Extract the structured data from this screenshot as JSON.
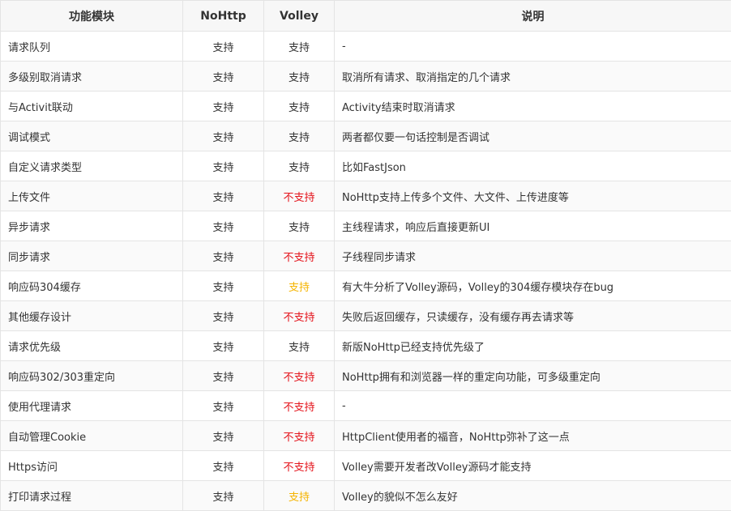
{
  "colors": {
    "supported": "#333333",
    "unsupported": "#e4121a",
    "partial": "#f5b400"
  },
  "table": {
    "headers": [
      "功能模块",
      "NoHttp",
      "Volley",
      "说明"
    ],
    "rows": [
      {
        "feature": "请求队列",
        "nohttp": "支持",
        "volley": "支持",
        "volley_status": "yes",
        "note": "-"
      },
      {
        "feature": "多级别取消请求",
        "nohttp": "支持",
        "volley": "支持",
        "volley_status": "yes",
        "note": "取消所有请求、取消指定的几个请求"
      },
      {
        "feature": "与Activit联动",
        "nohttp": "支持",
        "volley": "支持",
        "volley_status": "yes",
        "note": "Activity结束时取消请求"
      },
      {
        "feature": "调试模式",
        "nohttp": "支持",
        "volley": "支持",
        "volley_status": "yes",
        "note": "两者都仅要一句话控制是否调试"
      },
      {
        "feature": "自定义请求类型",
        "nohttp": "支持",
        "volley": "支持",
        "volley_status": "yes",
        "note": "比如FastJson"
      },
      {
        "feature": "上传文件",
        "nohttp": "支持",
        "volley": "不支持",
        "volley_status": "no",
        "note": "NoHttp支持上传多个文件、大文件、上传进度等"
      },
      {
        "feature": "异步请求",
        "nohttp": "支持",
        "volley": "支持",
        "volley_status": "yes",
        "note": "主线程请求，响应后直接更新UI"
      },
      {
        "feature": "同步请求",
        "nohttp": "支持",
        "volley": "不支持",
        "volley_status": "no",
        "note": "子线程同步请求"
      },
      {
        "feature": "响应码304缓存",
        "nohttp": "支持",
        "volley": "支持",
        "volley_status": "partial",
        "note": "有大牛分析了Volley源码，Volley的304缓存模块存在bug"
      },
      {
        "feature": "其他缓存设计",
        "nohttp": "支持",
        "volley": "不支持",
        "volley_status": "no",
        "note": "失败后返回缓存，只读缓存，没有缓存再去请求等"
      },
      {
        "feature": "请求优先级",
        "nohttp": "支持",
        "volley": "支持",
        "volley_status": "yes",
        "note": "新版NoHttp已经支持优先级了"
      },
      {
        "feature": "响应码302/303重定向",
        "nohttp": "支持",
        "volley": "不支持",
        "volley_status": "no",
        "note": "NoHttp拥有和浏览器一样的重定向功能，可多级重定向"
      },
      {
        "feature": "使用代理请求",
        "nohttp": "支持",
        "volley": "不支持",
        "volley_status": "no",
        "note": "-"
      },
      {
        "feature": "自动管理Cookie",
        "nohttp": "支持",
        "volley": "不支持",
        "volley_status": "no",
        "note": "HttpClient使用者的福音，NoHttp弥补了这一点"
      },
      {
        "feature": "Https访问",
        "nohttp": "支持",
        "volley": "不支持",
        "volley_status": "no",
        "note": "Volley需要开发者改Volley源码才能支持"
      },
      {
        "feature": "打印请求过程",
        "nohttp": "支持",
        "volley": "支持",
        "volley_status": "partial",
        "note": "Volley的貌似不怎么友好"
      }
    ]
  }
}
